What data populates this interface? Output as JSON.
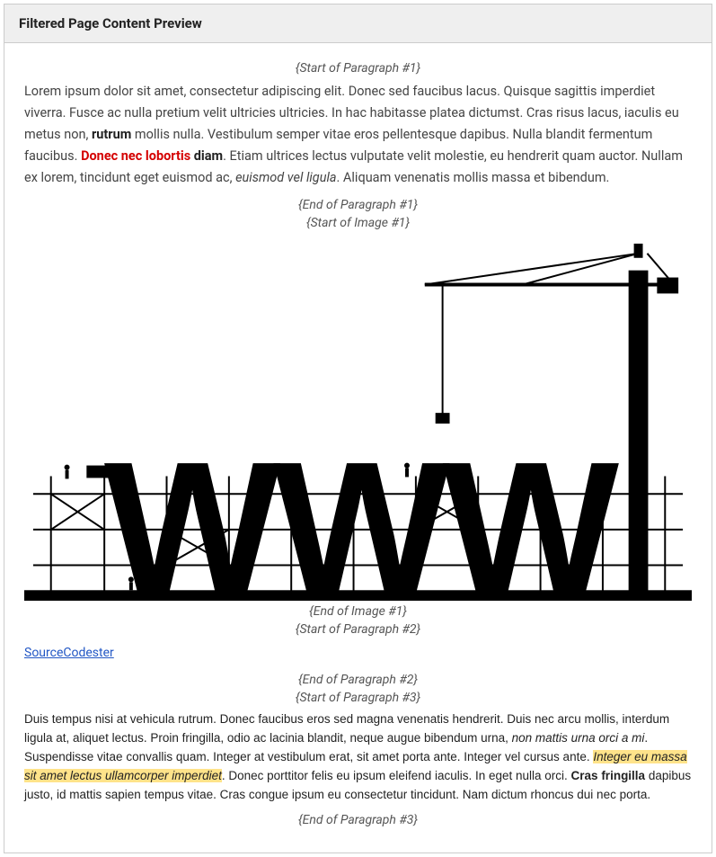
{
  "header": {
    "title": "Filtered Page Content Preview"
  },
  "markers": {
    "p1_start": "{Start of Paragraph #1}",
    "p1_end": "{End of Paragraph #1}",
    "img1_start": "{Start of Image #1}",
    "img1_end": "{End of Image #1}",
    "p2_start": "{Start of Paragraph #2}",
    "p2_end": "{End of Paragraph #2}",
    "p3_start": "{Start of Paragraph #3}",
    "p3_end": "{End of Paragraph #3}"
  },
  "paragraph1": {
    "t1": "Lorem ipsum dolor sit amet, consectetur adipiscing elit. Donec sed faucibus lacus. Quisque sagittis imperdiet viverra. Fusce ac nulla pretium velit ultricies ultricies. In hac habitasse platea dictumst. Cras risus lacus, iaculis eu metus non, ",
    "b1": "rutrum",
    "t2": " mollis nulla. Vestibulum semper vitae eros pellentesque dapibus. Nulla blandit fermentum faucibus. ",
    "r1": "Donec nec lobortis",
    "b2": " diam",
    "t3": ". Etiam ultrices lectus vulputate velit molestie, eu hendrerit quam auctor. Nullam ex lorem, tincidunt eget euismod ac, ",
    "i1": "euismod vel ligula",
    "t4": ". Aliquam venenatis mollis massa et bibendum."
  },
  "paragraph2": {
    "link_text": "SourceCodester",
    "link_href": "#"
  },
  "paragraph3": {
    "t1": "Duis tempus nisi at vehicula rutrum. Donec faucibus eros sed magna venenatis hendrerit. Duis nec arcu mollis, interdum ligula at, aliquet lectus. Proin fringilla, odio ac lacinia blandit, neque augue bibendum urna, ",
    "i1": "non mattis urna orci a mi",
    "t2": ". Suspendisse vitae convallis quam. Integer at vestibulum erat, sit amet porta ante. Integer vel cursus ante. ",
    "h1": "Integer eu massa sit amet lectus ullamcorper imperdiet",
    "t3": ". Donec porttitor felis eu ipsum eleifend iaculis. In eget nulla orci. ",
    "b1": "Cras fringilla",
    "t4": " dapibus justo, id mattis sapien tempus vitae. Cras congue ipsum eu consectetur tincidunt. Nam dictum rhoncus dui nec porta."
  }
}
